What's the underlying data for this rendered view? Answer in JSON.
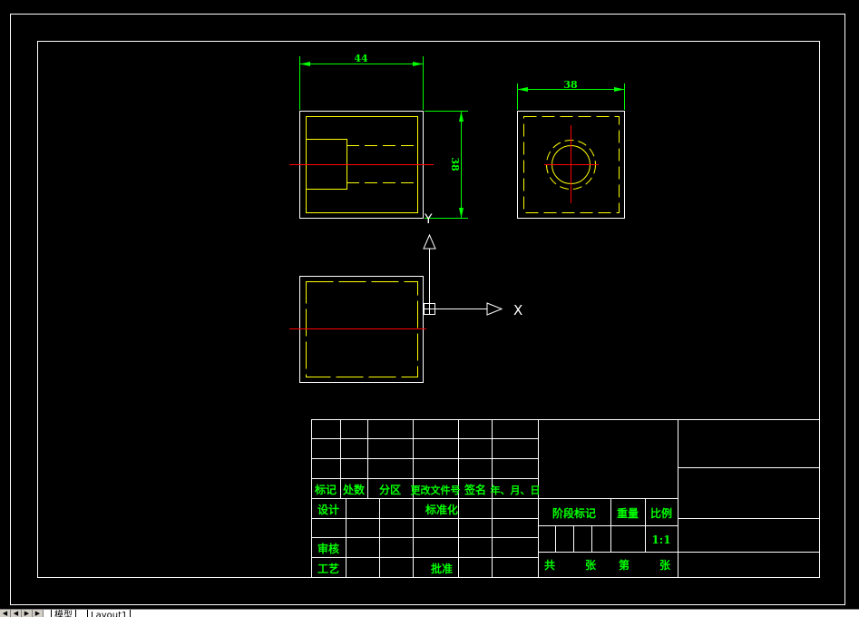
{
  "drawing": {
    "dimensions": {
      "front_width": "44",
      "front_height": "38",
      "side_width": "38"
    },
    "ucs": {
      "x_label": "X",
      "y_label": "Y"
    }
  },
  "title_block": {
    "headers": {
      "mark": "标记",
      "count": "处数",
      "zone": "分区",
      "change_doc": "更改文件号",
      "signature": "签名",
      "date": "年、月、日"
    },
    "design": "设计",
    "standardization": "标准化",
    "review": "审核",
    "process": "工艺",
    "approve": "批准",
    "stage_mark": "阶段标记",
    "weight": "重量",
    "scale": "比例",
    "scale_value": "1:1",
    "total": "共",
    "sheets": "张",
    "sheet_no": "第",
    "sheets2": "张"
  },
  "colors": {
    "background": "#000000",
    "border": "#ffffff",
    "part_outline": "#ffff00",
    "center_line": "#ff0000",
    "dimension": "#00ff00",
    "text": "#00ff00"
  },
  "tabs": {
    "model": "模型",
    "layout": "Layout1"
  },
  "nav": {
    "first": "◀",
    "prev": "◀",
    "next": "▶",
    "last": "▶"
  }
}
